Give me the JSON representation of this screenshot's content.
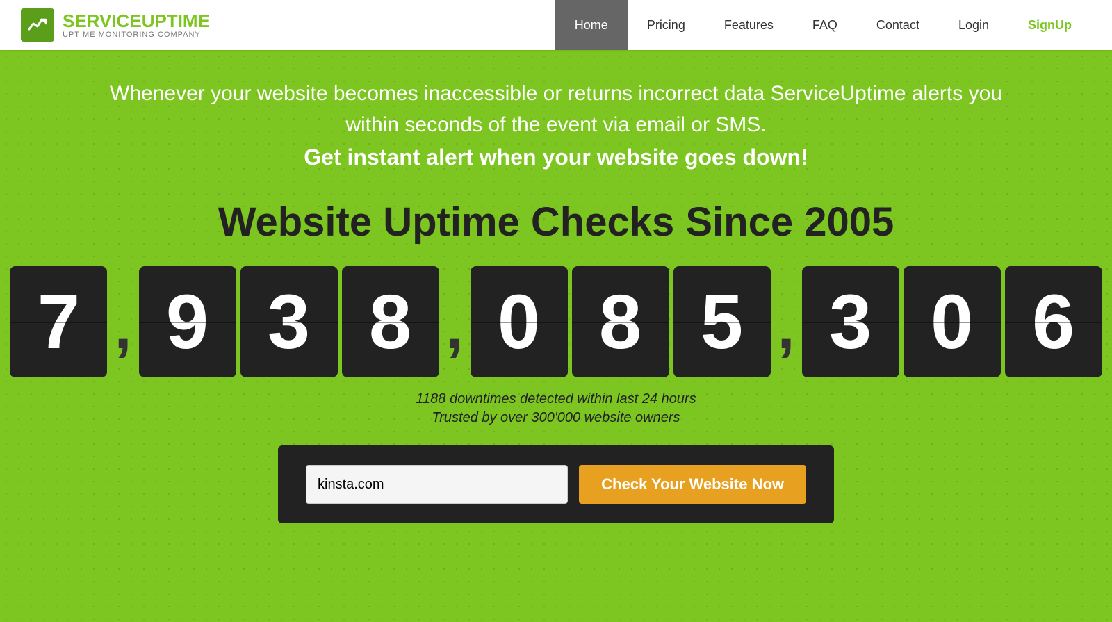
{
  "header": {
    "logo_main_prefix": "SERVICE",
    "logo_main_suffix": "UPTIME",
    "logo_sub": "UPTIME MONITORING COMPANY",
    "nav": [
      {
        "id": "home",
        "label": "Home",
        "active": true
      },
      {
        "id": "pricing",
        "label": "Pricing",
        "active": false
      },
      {
        "id": "features",
        "label": "Features",
        "active": false
      },
      {
        "id": "faq",
        "label": "FAQ",
        "active": false
      },
      {
        "id": "contact",
        "label": "Contact",
        "active": false
      },
      {
        "id": "login",
        "label": "Login",
        "active": false
      },
      {
        "id": "signup",
        "label": "SignUp",
        "active": false,
        "special": "signup"
      }
    ]
  },
  "hero": {
    "tagline_line1": "Whenever your website becomes inaccessible or returns incorrect data ServiceUptime alerts you",
    "tagline_line2": "within seconds of the event via email or SMS.",
    "tagline_bold": "Get instant alert when your website goes down!",
    "title": "Website Uptime Checks Since 2005",
    "counter_value": "7,938,085,306",
    "counter_digits": [
      "7",
      "9",
      "3",
      "8",
      "0",
      "8",
      "5",
      "3",
      "0",
      "6"
    ],
    "stat_downtimes": "1188 downtimes detected within last 24 hours",
    "stat_trusted": "Trusted by over 300'000 website owners",
    "input_placeholder": "kinsta.com",
    "input_value": "kinsta.com",
    "button_label": "Check Your Website Now"
  },
  "colors": {
    "green": "#7dc520",
    "dark": "#222222",
    "orange": "#e8a020",
    "active_nav": "#666666",
    "signup_green": "#7dc520"
  }
}
